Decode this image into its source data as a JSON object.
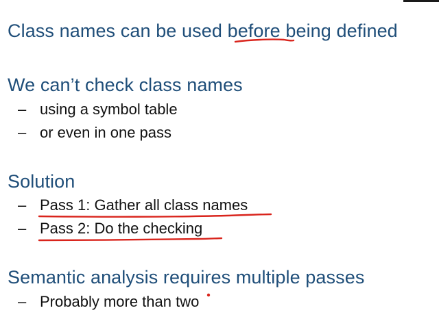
{
  "slide": {
    "heading1": {
      "before": "Class names can be used ",
      "emph": "before",
      "after": " being defined"
    },
    "heading2": "We can’t check class names",
    "heading2_bullets": [
      "using a symbol table",
      "or even in one pass"
    ],
    "heading3": "Solution",
    "heading3_bullets": [
      "Pass 1: Gather all class names",
      "Pass 2: Do the checking"
    ],
    "heading4": "Semantic analysis requires multiple passes",
    "heading4_bullets": [
      "Probably more than two"
    ],
    "bullet_dash": "–"
  },
  "colors": {
    "heading": "#1f4e79",
    "body": "#111111",
    "annotation": "#d9241c"
  }
}
